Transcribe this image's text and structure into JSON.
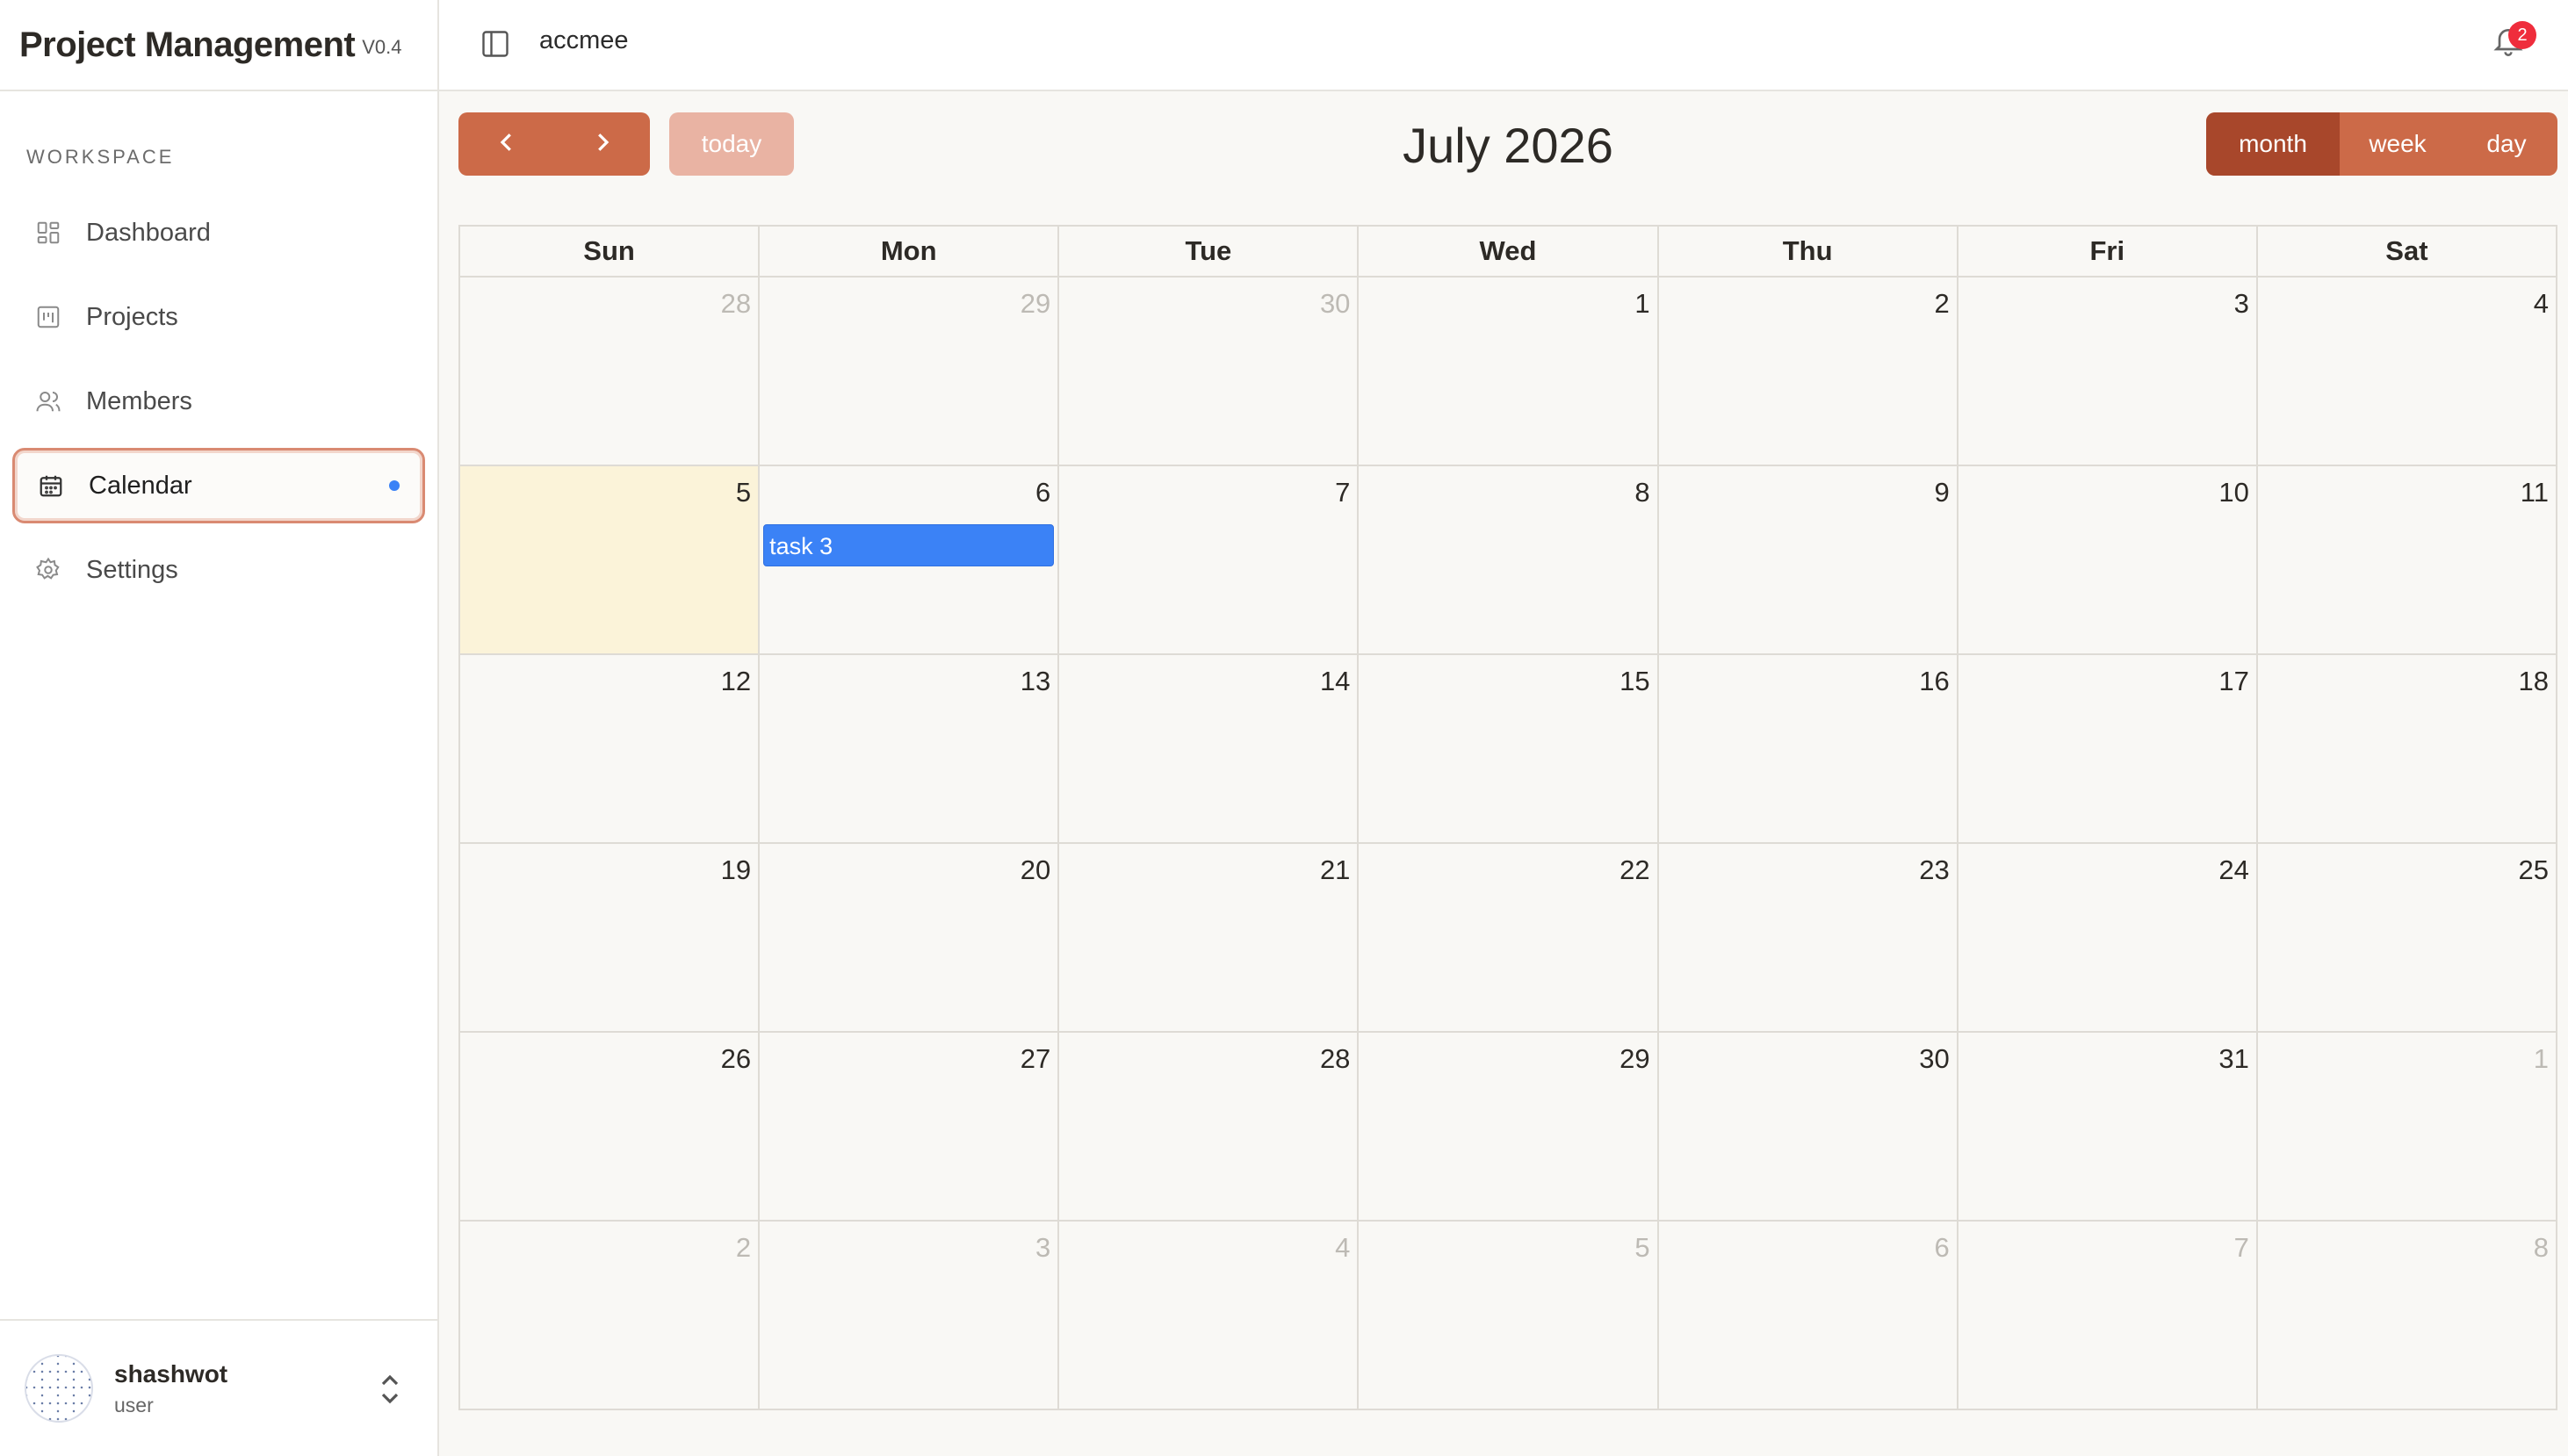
{
  "sidebar": {
    "brand": "Project Management",
    "version": "V0.4",
    "section_label": "WORKSPACE",
    "items": [
      {
        "label": "Dashboard"
      },
      {
        "label": "Projects"
      },
      {
        "label": "Members"
      },
      {
        "label": "Calendar"
      },
      {
        "label": "Settings"
      }
    ],
    "user": {
      "name": "shashwot",
      "role": "user"
    }
  },
  "topbar": {
    "workspace": "accmee",
    "notification_count": "2"
  },
  "calendar": {
    "title": "July 2026",
    "today_label": "today",
    "views": {
      "month": "month",
      "week": "week",
      "day": "day"
    },
    "weekdays": [
      "Sun",
      "Mon",
      "Tue",
      "Wed",
      "Thu",
      "Fri",
      "Sat"
    ],
    "weeks": [
      [
        "28",
        "29",
        "30",
        "1",
        "2",
        "3",
        "4"
      ],
      [
        "5",
        "6",
        "7",
        "8",
        "9",
        "10",
        "11"
      ],
      [
        "12",
        "13",
        "14",
        "15",
        "16",
        "17",
        "18"
      ],
      [
        "19",
        "20",
        "21",
        "22",
        "23",
        "24",
        "25"
      ],
      [
        "26",
        "27",
        "28",
        "29",
        "30",
        "31",
        "1"
      ],
      [
        "2",
        "3",
        "4",
        "5",
        "6",
        "7",
        "8"
      ]
    ],
    "event": {
      "label": "task 3"
    }
  },
  "colors": {
    "accent": "#cc6a48",
    "accent_dark": "#a8472b",
    "today_bg": "#fbf3d9",
    "event": "#3b82f6",
    "active_dot": "#3b82f6",
    "badge": "#ef2d3c"
  }
}
